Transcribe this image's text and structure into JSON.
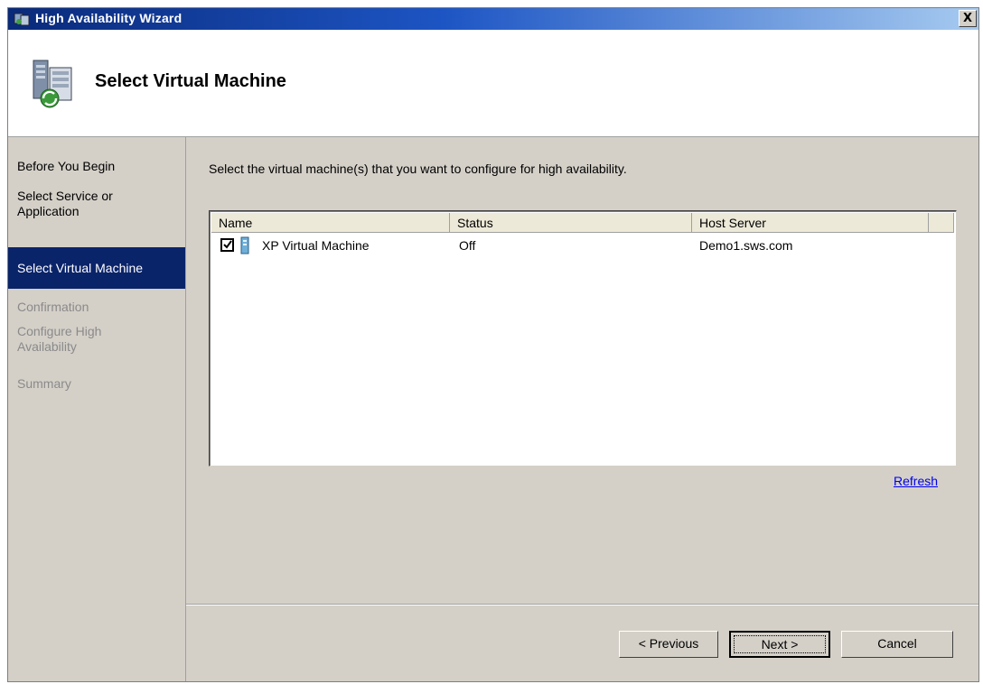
{
  "window": {
    "title": "High Availability Wizard",
    "close_label": "X"
  },
  "header": {
    "title": "Select Virtual Machine"
  },
  "nav": {
    "items": [
      {
        "label": "Before You Begin",
        "state": "completed"
      },
      {
        "label": "Select Service or Application",
        "state": "completed"
      },
      {
        "label": "Select Virtual Machine",
        "state": "active"
      },
      {
        "label": "Confirmation",
        "state": "disabled"
      },
      {
        "label": "Configure High Availability",
        "state": "disabled"
      },
      {
        "label": "Summary",
        "state": "disabled"
      }
    ]
  },
  "main": {
    "instruction": "Select the virtual machine(s) that you want to configure for high availability.",
    "columns": [
      "Name",
      "Status",
      "Host Server"
    ],
    "rows": [
      {
        "checked": true,
        "name": "XP Virtual Machine",
        "status": "Off",
        "host": "Demo1.sws.com"
      }
    ],
    "refresh_label": "Refresh"
  },
  "buttons": {
    "previous": "< Previous",
    "next": "Next >",
    "cancel": "Cancel"
  },
  "colors": {
    "active_nav": "#0a246a",
    "dialog_bg": "#d4d0c8",
    "link": "#0000ee"
  },
  "icons": {
    "title": "cluster-wizard-icon",
    "header": "server-cluster-icon",
    "row": "virtual-machine-icon"
  }
}
